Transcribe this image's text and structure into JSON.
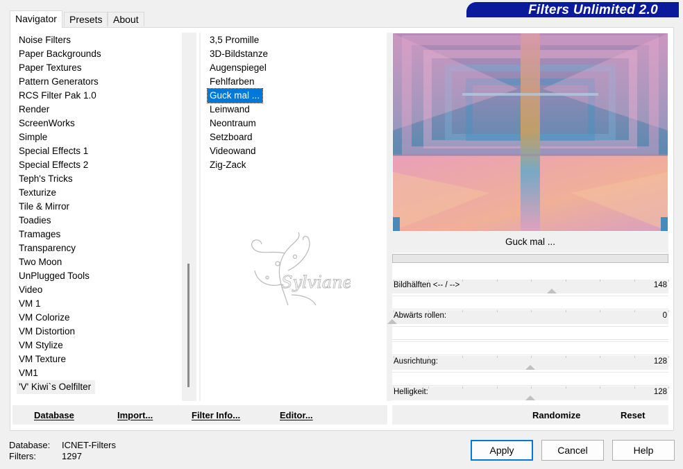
{
  "window": {
    "title": "Filters Unlimited 2.0"
  },
  "tabs": [
    {
      "label": "Navigator",
      "active": true
    },
    {
      "label": "Presets",
      "active": false
    },
    {
      "label": "About",
      "active": false
    }
  ],
  "categories": {
    "items": [
      "Noise Filters",
      "Paper Backgrounds",
      "Paper Textures",
      "Pattern Generators",
      "RCS Filter Pak 1.0",
      "Render",
      "ScreenWorks",
      "Simple",
      "Special Effects 1",
      "Special Effects 2",
      "Teph's Tricks",
      "Texturize",
      "Tile & Mirror",
      "Toadies",
      "Tramages",
      "Transparency",
      "Two Moon",
      "UnPlugged Tools",
      "Video",
      "VM 1",
      "VM Colorize",
      "VM Distortion",
      "VM Stylize",
      "VM Texture",
      "VM1",
      "'V' Kiwi`s Oelfilter"
    ],
    "highlighted_index": 25
  },
  "filters": {
    "items": [
      "3,5 Promille",
      "3D-Bildstanze",
      "Augenspiegel",
      "Fehlfarben",
      "Guck mal ...",
      "Leinwand",
      "Neontraum",
      "Setzboard",
      "Videowand",
      "Zig-Zack"
    ],
    "selected_index": 4
  },
  "list_buttons": {
    "database": "Database",
    "import": "Import...",
    "filter_info": "Filter Info...",
    "editor": "Editor..."
  },
  "watermark": {
    "text": "Sylviane"
  },
  "preview": {
    "filter_name": "Guck mal ...",
    "colors": {
      "pink": "#e8a8c8",
      "blue": "#5a9ac8",
      "peach": "#f0b898",
      "teal": "#4a8aa8"
    }
  },
  "params": [
    {
      "name": "Bildhälften <-- / -->",
      "value": "148",
      "level": 148
    },
    {
      "name": "Abwärts rollen:",
      "value": "0",
      "level": 0
    },
    {
      "name": "Ausrichtung:",
      "value": "128",
      "level": 128
    },
    {
      "name": "Helligkeit:",
      "value": "128",
      "level": 128
    }
  ],
  "param_buttons": {
    "randomize": "Randomize",
    "reset": "Reset"
  },
  "footer": {
    "database_label": "Database:",
    "database_value": "ICNET-Filters",
    "filters_label": "Filters:",
    "filters_value": "1297"
  },
  "dialog_buttons": {
    "apply": "Apply",
    "cancel": "Cancel",
    "help": "Help"
  },
  "colors": {
    "banner": "#0a1a9a",
    "selection": "#0078d7"
  }
}
